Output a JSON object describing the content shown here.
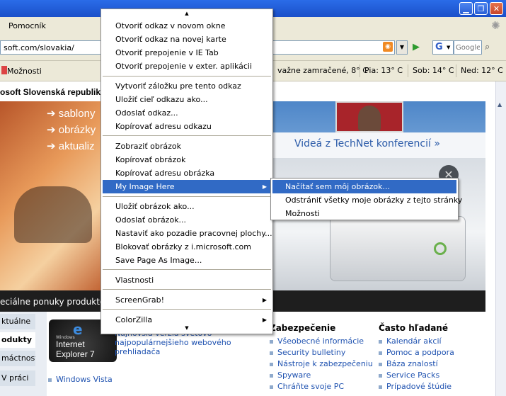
{
  "menubar": {
    "help": "Pomocník"
  },
  "address": {
    "url": "soft.com/slovakia/"
  },
  "search": {
    "placeholder": "Google"
  },
  "toolbar2": {
    "options_label": "Možnosti",
    "weather": [
      "važne zamračené, 8° C",
      "Pia: 13° C",
      "Sob: 14° C",
      "Ned: 12° C"
    ]
  },
  "page": {
    "header_title": "osoft Slovenská republika",
    "hero_lines": [
      "sablony",
      "obrázky",
      "aktualiz"
    ],
    "technet": "Videá z TechNet konferencií »",
    "dark_strip": "eciálne ponuky produkto",
    "ie_logo_small": "Windows",
    "ie_logo_line1": "Internet",
    "ie_logo_line2": "Explorer 7",
    "ie_text": [
      "Najnovšia verzia svetovo",
      "najpopulárnejšieho webového",
      "prehliadača"
    ],
    "vista_link": "Windows Vista",
    "left_nav": [
      "ktuálne",
      "odukty",
      "máctnosti",
      "V práci"
    ],
    "security": {
      "heading": "Zabezpečenie",
      "items": [
        "Všeobecné informácie",
        "Security bulletiny",
        "Nástroje k zabezpečeniu",
        "Spyware",
        "Chráňte svoje PC"
      ]
    },
    "frequent": {
      "heading": "Často hľadané",
      "items": [
        "Kalendár akcií",
        "Pomoc a podpora",
        "Báza znalostí",
        "Service Packs",
        "Prípadové štúdie"
      ]
    }
  },
  "context_menu": {
    "scroll_up": "▲",
    "scroll_down": "▼",
    "items": [
      "Otvoriť odkaz v novom okne",
      "Otvoriť odkaz na novej karte",
      "Otvoriť prepojenie v IE Tab",
      "Otvoriť prepojenie v exter. aplikácii",
      "Vytvoriť záložku pre tento odkaz",
      "Uložiť cieľ odkazu ako...",
      "Odoslať odkaz...",
      "Kopírovať adresu odkazu",
      "Zobraziť obrázok",
      "Kopírovať obrázok",
      "Kopírovať adresu obrázka",
      "My Image Here",
      "Uložiť obrázok ako...",
      "Odoslať obrázok...",
      "Nastaviť ako pozadie pracovnej plochy...",
      "Blokovať obrázky z i.microsoft.com",
      "Save Page As Image...",
      "Vlastnosti",
      "ScreenGrab!",
      "ColorZilla"
    ]
  },
  "submenu": {
    "items": [
      "Načítať sem môj obrázok...",
      "Odstrániť všetky moje obrázky z tejto stránky",
      "Možnosti"
    ]
  },
  "colors": {
    "highlight": "#316ac5",
    "titlebar": "#1a4fc9",
    "link": "#1f52b0"
  }
}
